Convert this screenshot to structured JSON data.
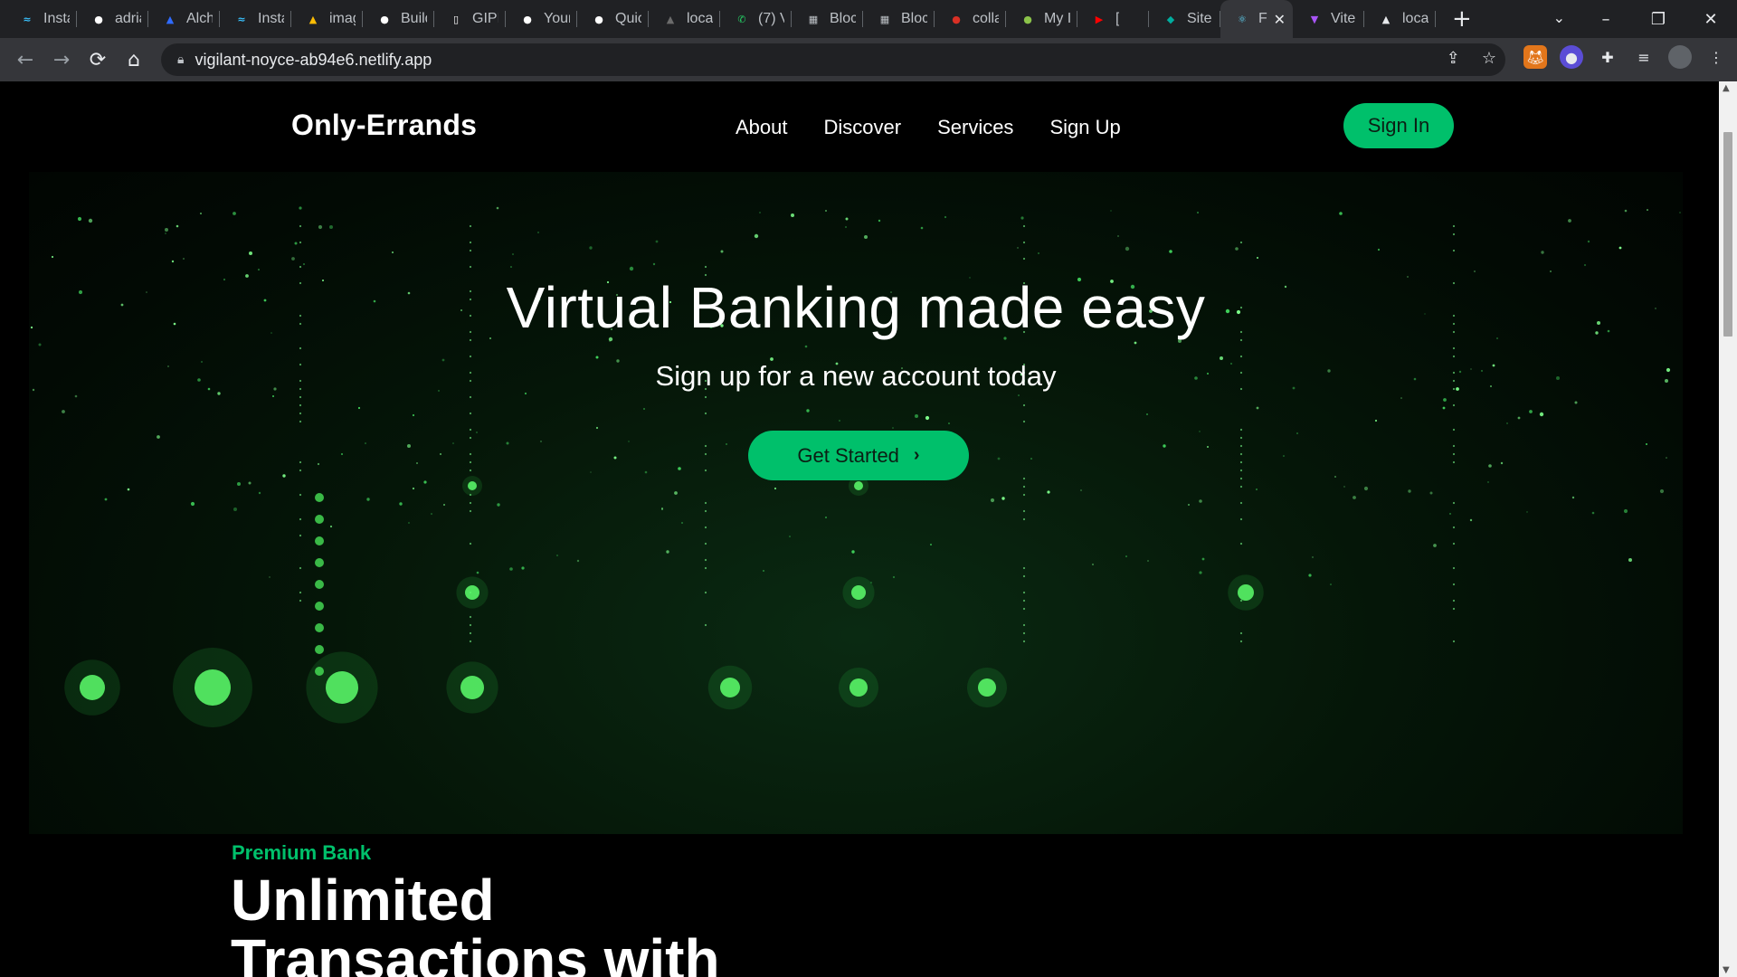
{
  "browser": {
    "tabs": [
      {
        "label": "Insta",
        "icon": "tailwind-icon",
        "color": "#38bdf8"
      },
      {
        "label": "adria",
        "icon": "github-icon",
        "color": "#ffffff"
      },
      {
        "label": "Alch",
        "icon": "alchemy-icon",
        "color": "#2f6bff"
      },
      {
        "label": "Insta",
        "icon": "tailwind-icon",
        "color": "#38bdf8"
      },
      {
        "label": "imag",
        "icon": "google-drive-icon",
        "color": "#fbbc04"
      },
      {
        "label": "Build",
        "icon": "github-icon",
        "color": "#ffffff"
      },
      {
        "label": "GIPH",
        "icon": "giphy-icon",
        "color": "#ffffff"
      },
      {
        "label": "Your",
        "icon": "github-icon",
        "color": "#ffffff"
      },
      {
        "label": "Quic",
        "icon": "github-icon",
        "color": "#ffffff"
      },
      {
        "label": "loca",
        "icon": "triangle-icon",
        "color": "#6b6b6b"
      },
      {
        "label": "(7) V",
        "icon": "whatsapp-icon",
        "color": "#25d366"
      },
      {
        "label": "Bloc",
        "icon": "block-icon",
        "color": "#bdc1c6"
      },
      {
        "label": "Bloc",
        "icon": "block-icon",
        "color": "#bdc1c6"
      },
      {
        "label": "colla",
        "icon": "calendar-badge-icon",
        "color": "#d93025"
      },
      {
        "label": "My I",
        "icon": "green-orb-icon",
        "color": "#8bc34a"
      },
      {
        "label": "[",
        "icon": "youtube-icon",
        "color": "#ff0000"
      },
      {
        "label": "Site",
        "icon": "diamond-icon",
        "color": "#00ad9f"
      },
      {
        "label": "F",
        "icon": "react-icon",
        "color": "#61dafb"
      },
      {
        "label": "Vite",
        "icon": "vite-icon",
        "color": "#a855f7"
      },
      {
        "label": "loca",
        "icon": "triangle-icon",
        "color": "#e8eaed"
      }
    ],
    "url": "vigilant-noyce-ab94e6.netlify.app"
  },
  "site": {
    "logo": "Only-Errands",
    "nav": [
      "About",
      "Discover",
      "Services",
      "Sign Up"
    ],
    "signin_label": "Sign In",
    "accent_color": "#00c06b"
  },
  "hero": {
    "title": "Virtual Banking made easy",
    "subtitle": "Sign up for a new account today",
    "cta_label": "Get Started",
    "cta_icon": "chevron-right-icon"
  },
  "feature": {
    "eyebrow": "Premium Bank",
    "title_line1": "Unlimited",
    "title_line2": "Transactions with"
  }
}
